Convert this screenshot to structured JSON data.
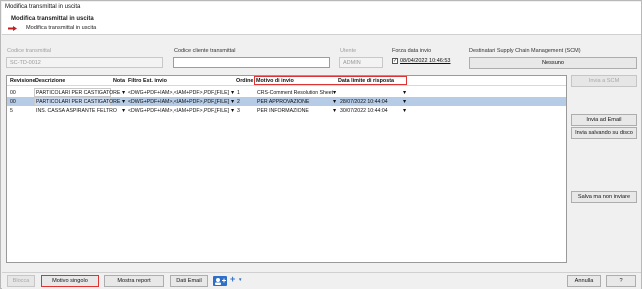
{
  "window": {
    "title": "Modifica transmittal in uscita"
  },
  "header": {
    "title": "Modifica transmittal in uscita",
    "subtitle": "Modifica transmittal in uscita"
  },
  "fields": {
    "codice_label": "Codice transmittal",
    "codice_value": "SC-TD-0012",
    "codice_cliente_label": "Codice cliente transmittal",
    "codice_cliente_value": "",
    "utente_label": "Utente",
    "utente_value": "ADMIN",
    "forza_label": "Forza data invio",
    "forza_value": "08/04/2022 10:46:53",
    "forza_checked": true,
    "scm_label": "Destinatari Supply Chain Management (SCM)",
    "scm_value": "Nessuno"
  },
  "grid": {
    "headers": [
      "Revisione",
      "Descrizione",
      "Nota",
      "Filtro Est. invio",
      "Ordine",
      "Motivo di invio",
      "Data limite di risposta"
    ],
    "rows": [
      {
        "rev": "00",
        "desc": "PARTICOLARI PER CASTIGATORE",
        "filtro": "<DWG+PDF+IAM>,<IAM+PDF>,PDF,[FILE]",
        "ordine": "1",
        "motivo": "CRS-Comment Resolution Sheet",
        "data": "",
        "selected": false
      },
      {
        "rev": "00",
        "desc": "PARTICOLARI PER CASTIGATORE",
        "filtro": "<DWG+PDF+IAM>,<IAM+PDF>,PDF,[FILE]",
        "ordine": "2",
        "motivo": "PER APPROVAZIONE",
        "data": "28/07/2022 10:44:04",
        "selected": true
      },
      {
        "rev": "5",
        "desc": "INS. CASSA ASPIRANTE FELTRO",
        "filtro": "<DWG+PDF+IAM>,<IAM+PDF>,PDF,[FILE]",
        "ordine": "3",
        "motivo": "PER INFORMAZIONE",
        "data": "30/07/2022 10:44:04",
        "selected": false
      }
    ]
  },
  "side_buttons": {
    "invia_scm": "Invia a SCM",
    "invia_email": "Invia ad Email",
    "invia_salvando": "Invia salvando su disco",
    "salva": "Salva ma non inviare"
  },
  "bottom": {
    "blocca": "Blocca",
    "motivo_singolo": "Motivo singolo",
    "mostra_report": "Mostra report",
    "dati_email": "Dati Email",
    "annulla": "Annulla",
    "help": "?"
  }
}
